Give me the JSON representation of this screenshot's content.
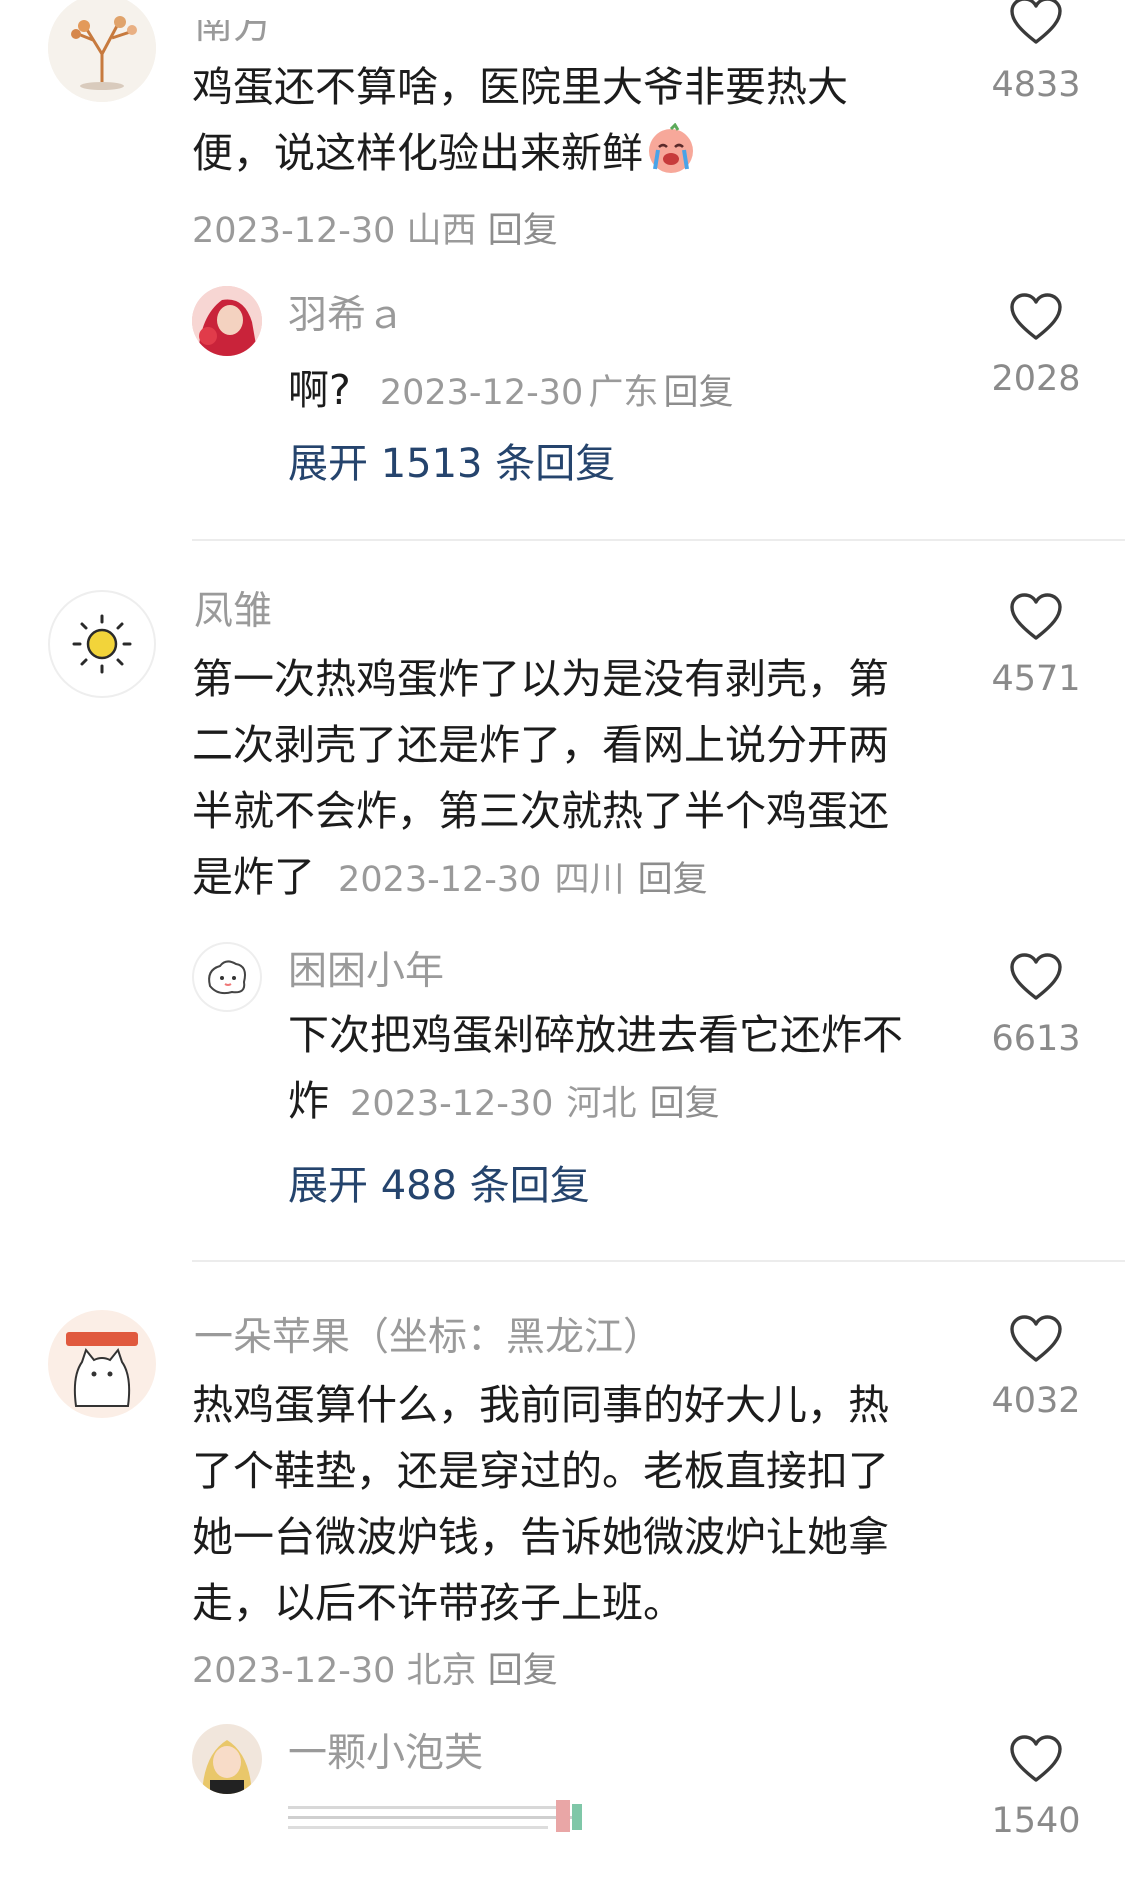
{
  "comments": [
    {
      "user": "南方",
      "text": "鸡蛋还不算啥，医院里大爷非要热大便，说这样化验出来新鲜",
      "emoji": "crying-face-emoji",
      "date": "2023-12-30",
      "location": "山西",
      "reply_label": "回复",
      "likes": "4833",
      "reply": {
        "user": "羽希ａ",
        "text": "啊?",
        "date": "2023-12-30",
        "location": "广东",
        "reply_label": "回复",
        "likes": "2028"
      },
      "expand": "展开 1513 条回复"
    },
    {
      "user": "凤雏",
      "text_lines": [
        "第一次热鸡蛋炸了以为是没有剥壳，第",
        "二次剥壳了还是炸了，看网上说分开两",
        "半就不会炸，第三次就热了半个鸡蛋还",
        "是炸了"
      ],
      "date": "2023-12-30",
      "location": "四川",
      "reply_label": "回复",
      "likes": "4571",
      "reply": {
        "user": "困困小年",
        "text_lines": [
          "下次把鸡蛋剁碎放进去看它还炸不",
          "炸"
        ],
        "date": "2023-12-30",
        "location": "河北",
        "reply_label": "回复",
        "likes": "6613"
      },
      "expand": "展开 488 条回复"
    },
    {
      "user": "一朵苹果（坐标：黑龙江）",
      "text_lines": [
        "热鸡蛋算什么，我前同事的好大儿，热",
        "了个鞋垫，还是穿过的。老板直接扣了",
        "她一台微波炉钱，告诉她微波炉让她拿",
        "走，以后不许带孩子上班。"
      ],
      "date": "2023-12-30",
      "location": "北京",
      "reply_label": "回复",
      "likes": "4032",
      "reply": {
        "user": "一颗小泡芙",
        "likes": "1540"
      }
    }
  ]
}
